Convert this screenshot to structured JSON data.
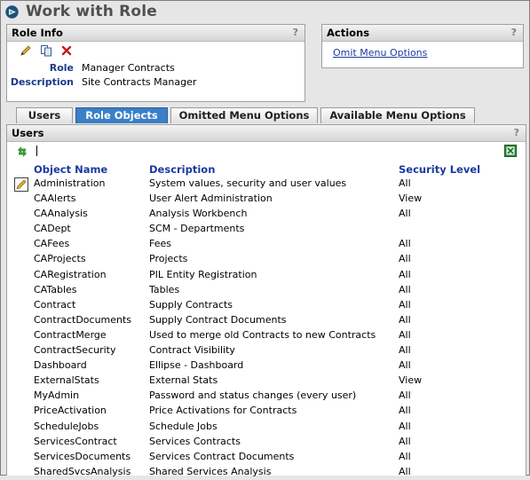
{
  "window": {
    "title": "Work with Role"
  },
  "role_info": {
    "header": "Role Info",
    "help": "?",
    "fields": [
      {
        "label": "Role",
        "value": "Manager Contracts"
      },
      {
        "label": "Description",
        "value": "Site Contracts Manager"
      }
    ]
  },
  "actions": {
    "header": "Actions",
    "help": "?",
    "link": "Omit Menu Options"
  },
  "tabs": [
    {
      "label": "Users",
      "active": false
    },
    {
      "label": "Role Objects",
      "active": true
    },
    {
      "label": "Omitted Menu Options",
      "active": false
    },
    {
      "label": "Available Menu Options",
      "active": false
    }
  ],
  "users": {
    "header": "Users",
    "help": "?",
    "columns": [
      "Object Name",
      "Description",
      "Security Level"
    ],
    "rows": [
      [
        "Administration",
        "System values, security and user values",
        "All"
      ],
      [
        "CAAlerts",
        "User Alert Administration",
        "View"
      ],
      [
        "CAAnalysis",
        "Analysis Workbench",
        "All"
      ],
      [
        "CADept",
        "SCM - Departments",
        ""
      ],
      [
        "CAFees",
        "Fees",
        "All"
      ],
      [
        "CAProjects",
        "Projects",
        "All"
      ],
      [
        "CARegistration",
        "PIL Entity Registration",
        "All"
      ],
      [
        "CATables",
        "Tables",
        "All"
      ],
      [
        "Contract",
        "Supply Contracts",
        "All"
      ],
      [
        "ContractDocuments",
        "Supply Contract Documents",
        "All"
      ],
      [
        "ContractMerge",
        "Used to merge old Contracts to new Contracts",
        "All"
      ],
      [
        "ContractSecurity",
        "Contract Visibility",
        "All"
      ],
      [
        "Dashboard",
        "Ellipse - Dashboard",
        "All"
      ],
      [
        "ExternalStats",
        "External Stats",
        "View"
      ],
      [
        "MyAdmin",
        "Password and status changes (every user)",
        "All"
      ],
      [
        "PriceActivation",
        "Price Activations for Contracts",
        "All"
      ],
      [
        "ScheduleJobs",
        "Schedule Jobs",
        "All"
      ],
      [
        "ServicesContract",
        "Services Contracts",
        "All"
      ],
      [
        "ServicesDocuments",
        "Services Contract Documents",
        "All"
      ],
      [
        "SharedSvcsAnalysis",
        "Shared Services Analysis",
        "All"
      ]
    ]
  },
  "colors": {
    "tab_active": "#3a7fc8",
    "link": "#1a3aa0",
    "label": "#1a3a8a"
  }
}
